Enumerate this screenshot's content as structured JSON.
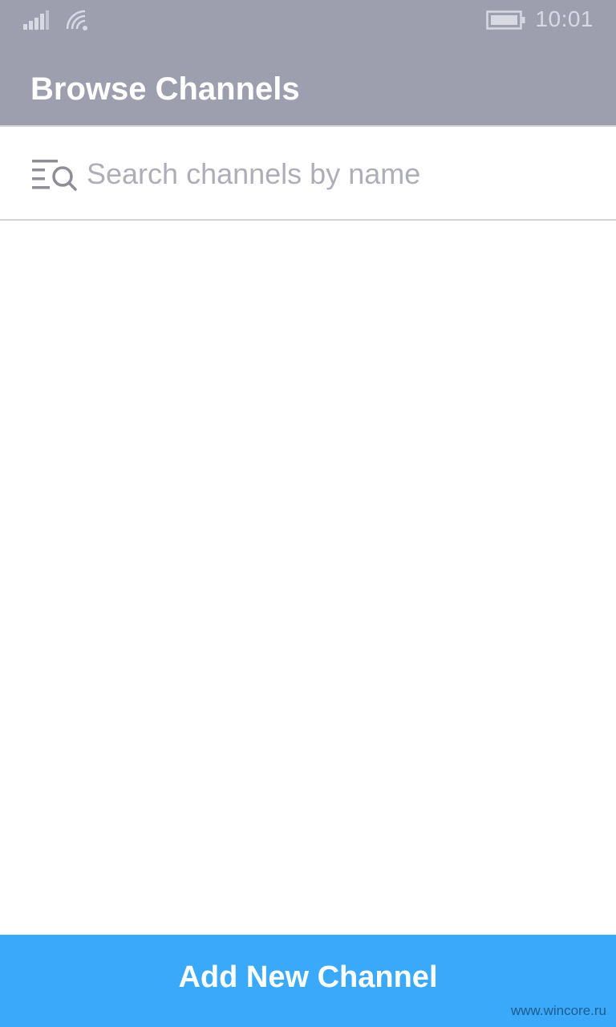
{
  "status_bar": {
    "time": "10:01",
    "signal_icon": "signal-strength-icon",
    "wifi_icon": "wifi-icon",
    "battery_icon": "battery-icon",
    "icon_color": "#d8d9e2"
  },
  "header": {
    "title": "Browse Channels",
    "background": "#9e9fae"
  },
  "search": {
    "placeholder": "Search channels by name",
    "value": "",
    "icon": "search-list-icon"
  },
  "channels": [],
  "footer": {
    "add_button_label": "Add New Channel",
    "button_color": "#3aa9fa"
  },
  "watermark": "www.wincore.ru"
}
